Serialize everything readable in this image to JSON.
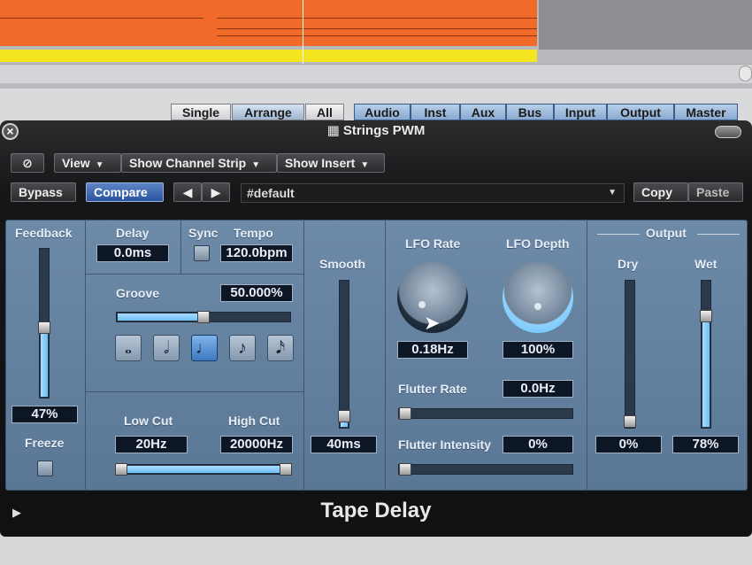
{
  "window": {
    "title": "Strings PWM",
    "plugin_name": "Tape Delay"
  },
  "mixer_tabs": [
    "Single",
    "Arrange",
    "All",
    "Audio",
    "Inst",
    "Aux",
    "Bus",
    "Input",
    "Output",
    "Master"
  ],
  "toolbar": {
    "link_icon": "link-icon",
    "view_label": "View",
    "show_channel_strip_label": "Show Channel Strip",
    "show_insert_label": "Show Insert",
    "bypass_label": "Bypass",
    "compare_label": "Compare",
    "preset_value": "#default",
    "copy_label": "Copy",
    "paste_label": "Paste"
  },
  "feedback": {
    "label": "Feedback",
    "value": "47%",
    "level": 0.47
  },
  "freeze": {
    "label": "Freeze"
  },
  "delay": {
    "label": "Delay",
    "value": "0.0ms"
  },
  "sync": {
    "label": "Sync"
  },
  "tempo": {
    "label": "Tempo",
    "value": "120.0bpm"
  },
  "groove": {
    "label": "Groove",
    "value": "50.000%",
    "level": 0.5
  },
  "notes": {
    "selected_index": 2,
    "icons": [
      "whole-note-icon",
      "half-note-icon",
      "quarter-note-icon",
      "eighth-note-icon",
      "sixteenth-note-icon"
    ]
  },
  "low_cut": {
    "label": "Low Cut",
    "value": "20Hz"
  },
  "high_cut": {
    "label": "High Cut",
    "value": "20000Hz"
  },
  "smooth": {
    "label": "Smooth",
    "value": "40ms",
    "level": 0.04
  },
  "lfo_rate": {
    "label": "LFO Rate",
    "value": "0.18Hz"
  },
  "lfo_depth": {
    "label": "LFO Depth",
    "value": "100%"
  },
  "flutter_rate": {
    "label": "Flutter Rate",
    "value": "0.0Hz",
    "level": 0.0
  },
  "flutter_intensity": {
    "label": "Flutter Intensity",
    "value": "0%",
    "level": 0.0
  },
  "output": {
    "label": "Output",
    "dry_label": "Dry",
    "dry_value": "0%",
    "dry_level": 0.0,
    "wet_label": "Wet",
    "wet_value": "78%",
    "wet_level": 0.78
  }
}
